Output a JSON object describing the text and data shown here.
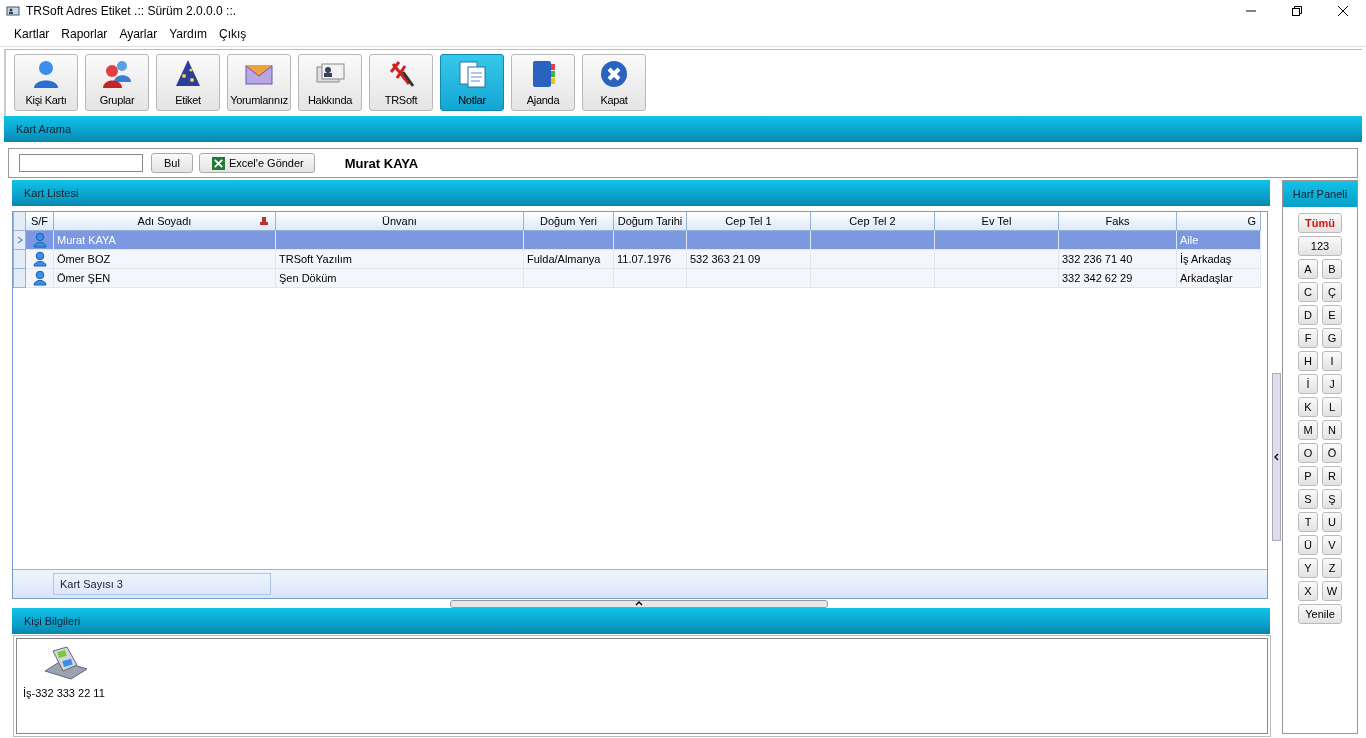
{
  "window": {
    "title": "TRSoft Adres Etiket  .:: Sürüm 2.0.0.0 ::."
  },
  "menu": [
    "Kartlar",
    "Raporlar",
    "Ayarlar",
    "Yardım",
    "Çıkış"
  ],
  "toolbar": [
    {
      "label": "Kişi Kartı",
      "selected": false
    },
    {
      "label": "Gruplar",
      "selected": false
    },
    {
      "label": "Etiket",
      "selected": false
    },
    {
      "label": "Yorumlarınız",
      "selected": false
    },
    {
      "label": "Hakkında",
      "selected": false
    },
    {
      "label": "TRSoft",
      "selected": false
    },
    {
      "label": "Notlar",
      "selected": true
    },
    {
      "label": "Ajanda",
      "selected": false
    },
    {
      "label": "Kapat",
      "selected": false
    }
  ],
  "search_panel": {
    "title": "Kart Arama",
    "find_button": "Bul",
    "excel_button": "Excel'e Gönder",
    "current_name": "Murat KAYA"
  },
  "card_list": {
    "title": "Kart Listesi",
    "columns": [
      "S/F",
      "Adı Soyadı",
      "Ünvanı",
      "Doğum Yeri",
      "Doğum Tarihi",
      "Cep Tel 1",
      "Cep Tel 2",
      "Ev Tel",
      "Faks",
      "G"
    ],
    "rows": [
      {
        "selected": true,
        "cells": [
          "",
          "Murat KAYA",
          "",
          "",
          "",
          "",
          "",
          "",
          "",
          "Aile"
        ]
      },
      {
        "selected": false,
        "cells": [
          "",
          "Ömer BOZ",
          "TRSoft Yazılım",
          "Fulda/Almanya",
          "11.07.1976",
          "532 363 21 09",
          "",
          "",
          "332 236 71 40",
          "İş Arkadaş"
        ]
      },
      {
        "selected": false,
        "cells": [
          "",
          "Ömer ŞEN",
          "Şen Döküm",
          "",
          "",
          "",
          "",
          "",
          "332 342 62 29",
          "Arkadaşlar"
        ]
      }
    ],
    "footer": "Kart Sayısı 3"
  },
  "person_info": {
    "title": "Kişi Bilgileri",
    "phone": "İş-332 333 22 11"
  },
  "letter_panel": {
    "title": "Harf Paneli",
    "all_button": "Tümü",
    "digits_button": "123",
    "letters": [
      "A",
      "B",
      "C",
      "Ç",
      "D",
      "E",
      "F",
      "G",
      "H",
      "I",
      "İ",
      "J",
      "K",
      "L",
      "M",
      "N",
      "O",
      "Ö",
      "P",
      "R",
      "S",
      "Ş",
      "T",
      "U",
      "Ü",
      "V",
      "Y",
      "Z",
      "X",
      "W"
    ],
    "refresh_button": "Yenile"
  }
}
